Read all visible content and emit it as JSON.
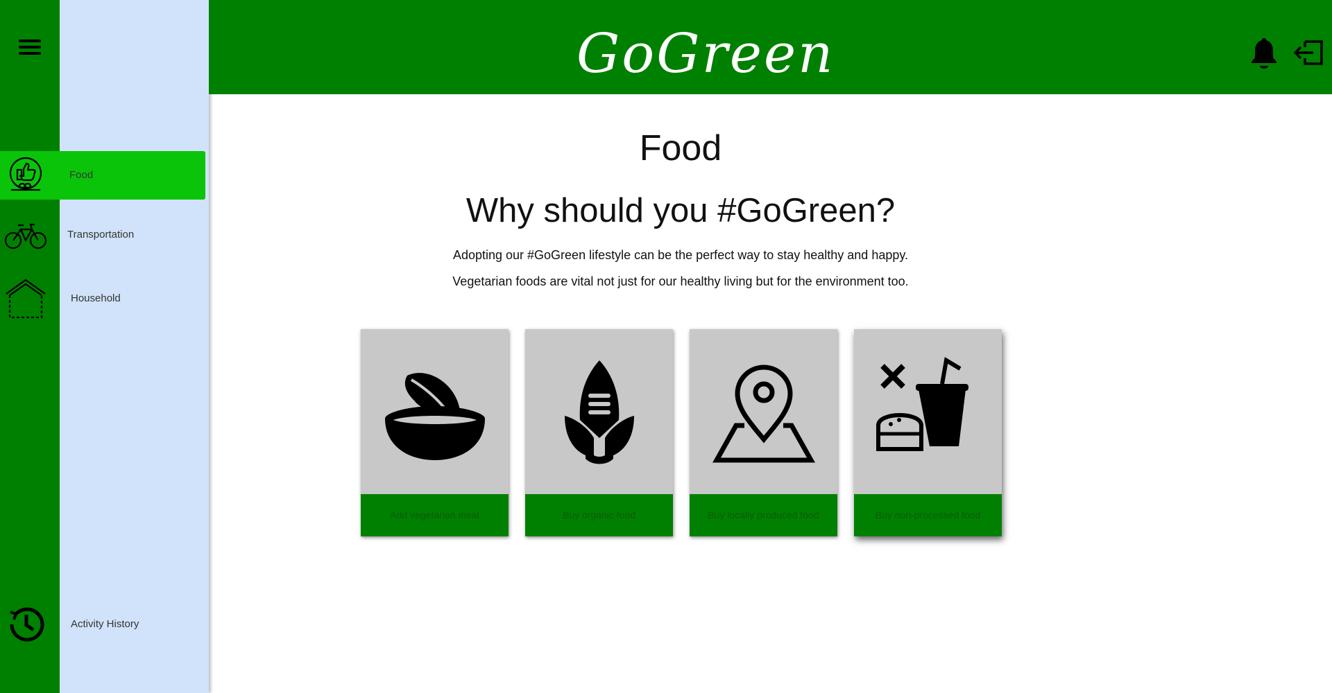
{
  "app": {
    "title": "GoGreen"
  },
  "sidebar": {
    "menu_icon": "hamburger-menu-icon",
    "items": [
      {
        "label": "Food",
        "icon": "thumbs-up-food-icon",
        "active": true
      },
      {
        "label": "Transportation",
        "icon": "bicycle-icon",
        "active": false
      },
      {
        "label": "Household",
        "icon": "house-icon",
        "active": false
      },
      {
        "label": "Activity History",
        "icon": "history-icon",
        "active": false
      }
    ]
  },
  "header": {
    "notification_icon": "bell-icon",
    "logout_icon": "logout-icon"
  },
  "main": {
    "title": "Food",
    "headline": "Why should you #GoGreen?",
    "paragraph_1": "Adopting our #GoGreen lifestyle can be the perfect way to stay healthy and happy.",
    "paragraph_2": "Vegetarian foods are vital not just for our healthy living but for the environment too.",
    "cards": [
      {
        "label": "Add vegetarian meal",
        "icon": "salad-bowl-icon"
      },
      {
        "label": "Buy organic food",
        "icon": "corn-icon"
      },
      {
        "label": "Buy locally produced food",
        "icon": "map-pin-icon"
      },
      {
        "label": "Buy non-processed food",
        "icon": "burger-drink-icon"
      }
    ]
  },
  "colors": {
    "primary_green": "#008000",
    "active_green": "#0ac40a",
    "sidebar_blue": "#d1e3fa",
    "card_gray": "#c8c8c8"
  }
}
